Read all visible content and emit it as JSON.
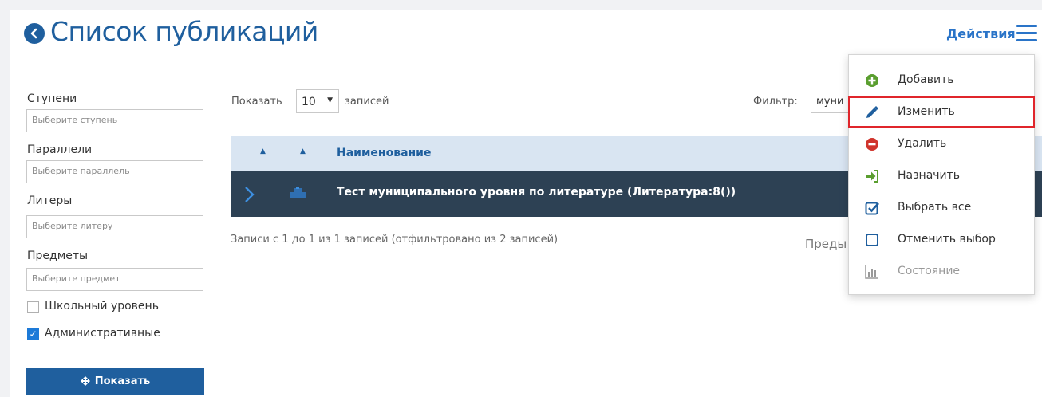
{
  "header": {
    "title": "Список публикаций",
    "actions_label": "Действия"
  },
  "filters": {
    "stages_label": "Ступени",
    "stages_placeholder": "Выберите ступень",
    "parallels_label": "Параллели",
    "parallels_placeholder": "Выберите параллель",
    "liters_label": "Литеры",
    "liters_placeholder": "Выберите литеру",
    "subjects_label": "Предметы",
    "subjects_placeholder": "Выберите предмет",
    "school_level_label": "Школьный уровень",
    "school_level_checked": false,
    "administrative_label": "Административные",
    "administrative_checked": true,
    "show_button_label": "Показать"
  },
  "table": {
    "show_prefix": "Показать",
    "page_size": "10",
    "show_suffix": "записей",
    "filter_label": "Фильтр:",
    "filter_value": "муни",
    "column_name": "Наименование",
    "rows": [
      {
        "name": "Тест муниципального уровня по литературе (Литература:8())"
      }
    ],
    "info": "Записи с 1 до 1 из 1 записей (отфильтровано из 2 записей)",
    "prev_label": "Преды"
  },
  "menu": {
    "items": [
      {
        "label": "Добавить",
        "icon": "plus-circle-icon",
        "color": "#5a9e2f"
      },
      {
        "label": "Изменить",
        "icon": "pencil-icon",
        "color": "#1f5f9e",
        "highlighted": true
      },
      {
        "label": "Удалить",
        "icon": "minus-circle-icon",
        "color": "#d0342c"
      },
      {
        "label": "Назначить",
        "icon": "sign-in-icon",
        "color": "#5a9e2f"
      },
      {
        "label": "Выбрать все",
        "icon": "check-square-icon",
        "color": "#1f5f9e"
      },
      {
        "label": "Отменить выбор",
        "icon": "square-icon",
        "color": "#1f5f9e"
      },
      {
        "label": "Состояние",
        "icon": "bar-chart-icon",
        "color": "#999999",
        "disabled": true
      }
    ]
  },
  "colors": {
    "brand": "#1f5f9e",
    "accent": "#2a74c8",
    "row_selected": "#2d4154",
    "header_row": "#d9e5f2",
    "highlight_border": "#e0252b"
  }
}
